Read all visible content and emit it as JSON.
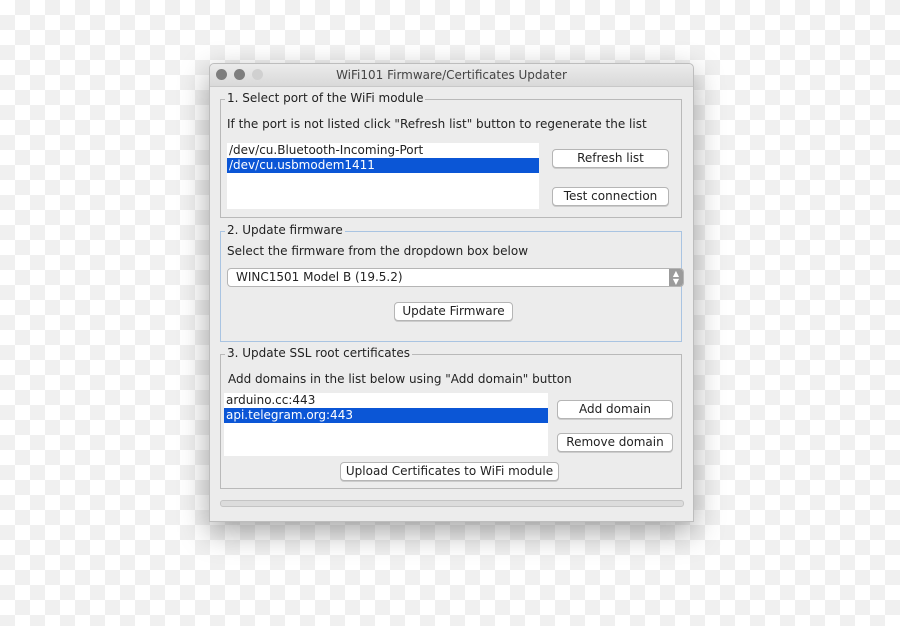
{
  "window": {
    "title": "WiFi101 Firmware/Certificates Updater"
  },
  "section1": {
    "legend": "1. Select port of the WiFi module",
    "instructions": "If the port is not listed click \"Refresh list\" button to regenerate the list",
    "ports": [
      "/dev/cu.Bluetooth-Incoming-Port",
      "/dev/cu.usbmodem1411"
    ],
    "selected_index": 1,
    "refresh_label": "Refresh list",
    "test_label": "Test connection"
  },
  "section2": {
    "legend": "2. Update firmware",
    "instructions": "Select the firmware from the dropdown box below",
    "firmware_selected": "WINC1501 Model B (19.5.2)",
    "update_label": "Update Firmware"
  },
  "section3": {
    "legend": "3. Update SSL root certificates",
    "instructions": "Add domains in the list below using \"Add domain\" button",
    "domains": [
      "arduino.cc:443",
      "api.telegram.org:443"
    ],
    "selected_index": 1,
    "add_label": "Add domain",
    "remove_label": "Remove domain",
    "upload_label": "Upload Certificates to WiFi module"
  },
  "progress": 0,
  "colors": {
    "selection": "#0b56d6",
    "window": "#ececec"
  }
}
